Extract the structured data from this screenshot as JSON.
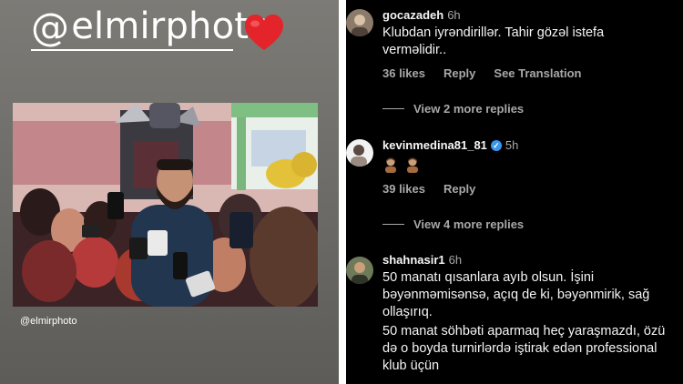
{
  "story": {
    "mention_at": "@",
    "mention_name": "elmirphoto",
    "heart_icon": "red-heart-emoji",
    "credit": "@elmirphoto"
  },
  "comments": [
    {
      "username": "gocazadeh",
      "time": "6h",
      "verified": false,
      "text": "Klubdan iyrəndirillər. Tahir gözəl istefa verməlidir..",
      "likes": "36 likes",
      "reply": "Reply",
      "translate": "See Translation",
      "more_replies": "View 2 more replies"
    },
    {
      "username": "kevinmedina81_81",
      "time": "5h",
      "verified": true,
      "emojis": [
        "person-emoji",
        "person-emoji"
      ],
      "likes": "39 likes",
      "reply": "Reply",
      "more_replies": "View 4 more replies"
    },
    {
      "username": "shahnasir1",
      "time": "6h",
      "verified": false,
      "text_1": "50 manatı qısanlara ayıb olsun. İşini bəyənməmisənsə, açıq de ki, bəyənmirik, sağ ollaşırıq.",
      "text_2": "50 manat söhbəti aparmaq heç yaraşmazdı, özü də o boyda turnirlərdə iştirak edən professional klub üçün"
    }
  ],
  "colors": {
    "comments_bg": "#000000",
    "secondary_text": "#a8a8a8",
    "verified_blue": "#3897f0",
    "heart_red": "#e3242b"
  }
}
